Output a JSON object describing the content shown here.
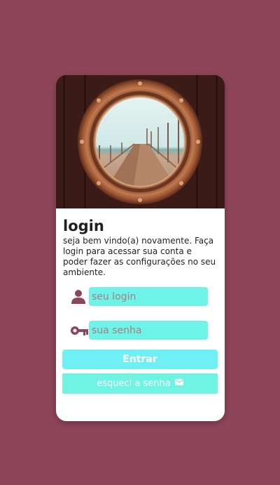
{
  "login": {
    "title": "login",
    "subtitle": "seja bem vindo(a) novamente. Faça login para acessar sua conta e poder fazer as configurações no seu ambiente.",
    "username_placeholder": "seu login",
    "password_placeholder": "sua senha",
    "submit_label": "Entrar",
    "forgot_label": "esqueci a senha"
  },
  "icons": {
    "user": "user-icon",
    "password": "key-icon",
    "forgot": "mail-icon"
  },
  "colors": {
    "background": "#8e455a",
    "card": "#ffffff",
    "input_fill": "#6ef4e6",
    "button_fill": "#6ff0f4",
    "icon": "#8e455a"
  }
}
